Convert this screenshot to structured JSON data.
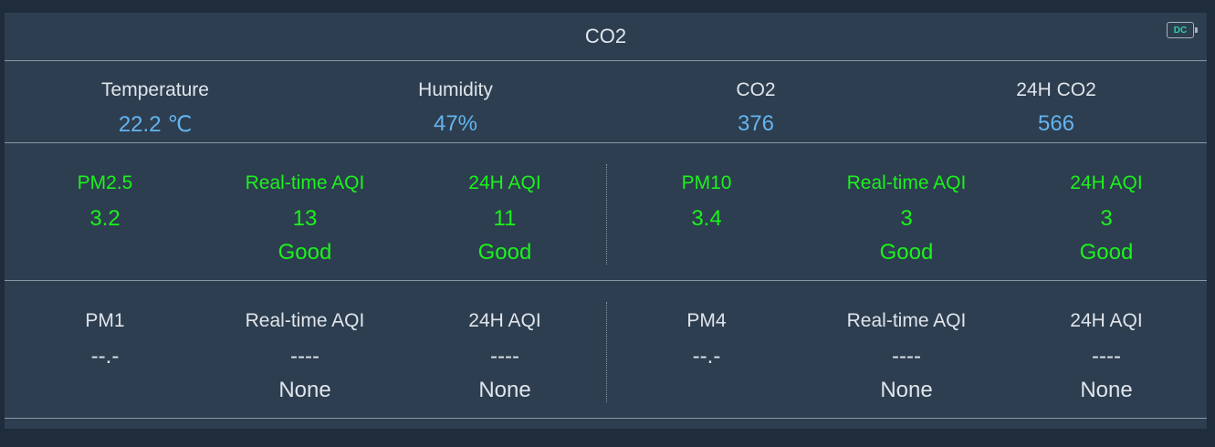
{
  "header": {
    "title": "CO2",
    "power_badge": "DC",
    "power_icon": "battery-dc-icon"
  },
  "summary": [
    {
      "label": "Temperature",
      "value": "22.2 ℃"
    },
    {
      "label": "Humidity",
      "value": "47%"
    },
    {
      "label": "CO2",
      "value": "376"
    },
    {
      "label": "24H CO2",
      "value": "566"
    }
  ],
  "pm_row_active": {
    "color": "#1bf21b",
    "left": [
      {
        "label": "PM2.5",
        "value": "3.2",
        "status": ""
      },
      {
        "label": "Real-time AQI",
        "value": "13",
        "status": "Good"
      },
      {
        "label": "24H AQI",
        "value": "11",
        "status": "Good"
      }
    ],
    "right": [
      {
        "label": "PM10",
        "value": "3.4",
        "status": ""
      },
      {
        "label": "Real-time AQI",
        "value": "3",
        "status": "Good"
      },
      {
        "label": "24H AQI",
        "value": "3",
        "status": "Good"
      }
    ]
  },
  "pm_row_inactive": {
    "color": "#dfe4ea",
    "left": [
      {
        "label": "PM1",
        "value": "--.-",
        "status": ""
      },
      {
        "label": "Real-time AQI",
        "value": "----",
        "status": "None"
      },
      {
        "label": "24H AQI",
        "value": "----",
        "status": "None"
      }
    ],
    "right": [
      {
        "label": "PM4",
        "value": "--.-",
        "status": ""
      },
      {
        "label": "Real-time AQI",
        "value": "----",
        "status": "None"
      },
      {
        "label": "24H AQI",
        "value": "----",
        "status": "None"
      }
    ]
  },
  "colors": {
    "page_bg": "#1f2c3b",
    "panel_bg": "#2d3e50",
    "value_blue": "#63b4ef",
    "good_green": "#1bf21b"
  }
}
